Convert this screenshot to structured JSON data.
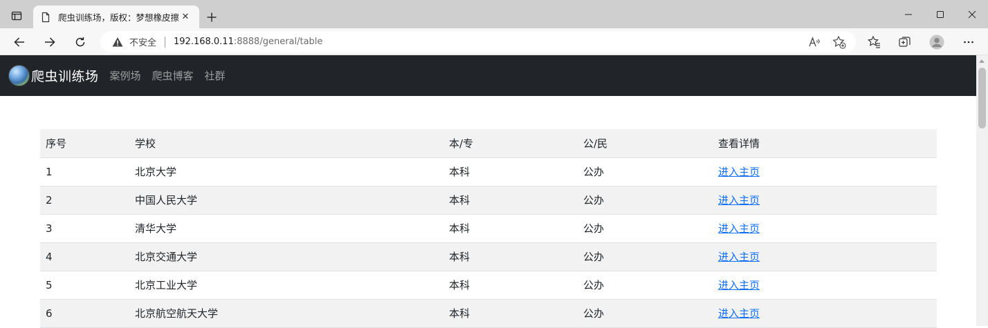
{
  "browser": {
    "tab_title": "爬虫训练场，版权：梦想橡皮擦",
    "tab_close": "✕",
    "new_tab": "+",
    "address": {
      "insecure_label": "不安全",
      "host": "192.168.0.11",
      "rest": ":8888/general/table"
    }
  },
  "navbar": {
    "brand": "爬虫训练场",
    "links": [
      "案例场",
      "爬虫博客",
      "社群"
    ]
  },
  "table": {
    "headers": [
      "序号",
      "学校",
      "本/专",
      "公/民",
      "查看详情"
    ],
    "rows": [
      {
        "no": "1",
        "school": "北京大学",
        "level": "本科",
        "type": "公办",
        "link": "进入主页"
      },
      {
        "no": "2",
        "school": "中国人民大学",
        "level": "本科",
        "type": "公办",
        "link": "进入主页"
      },
      {
        "no": "3",
        "school": "清华大学",
        "level": "本科",
        "type": "公办",
        "link": "进入主页"
      },
      {
        "no": "4",
        "school": "北京交通大学",
        "level": "本科",
        "type": "公办",
        "link": "进入主页"
      },
      {
        "no": "5",
        "school": "北京工业大学",
        "level": "本科",
        "type": "公办",
        "link": "进入主页"
      },
      {
        "no": "6",
        "school": "北京航空航天大学",
        "level": "本科",
        "type": "公办",
        "link": "进入主页"
      }
    ]
  }
}
